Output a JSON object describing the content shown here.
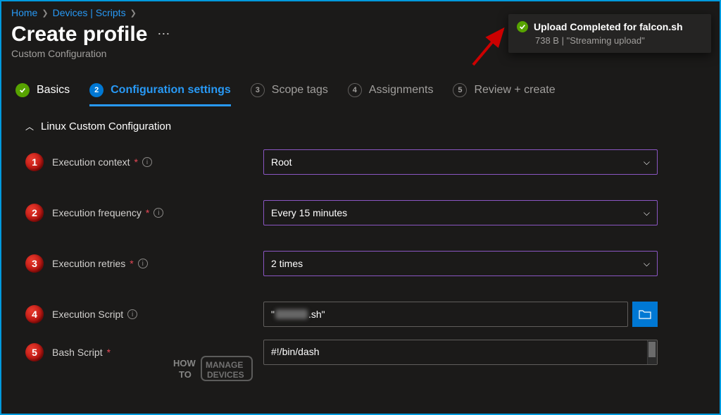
{
  "breadcrumb": {
    "home": "Home",
    "devices": "Devices | Scripts"
  },
  "page": {
    "title": "Create profile",
    "subtitle": "Custom Configuration"
  },
  "toast": {
    "title": "Upload Completed for falcon.sh",
    "sub": "738 B | \"Streaming upload\""
  },
  "steps": {
    "basics": "Basics",
    "config": "Configuration settings",
    "scope": "Scope tags",
    "assign": "Assignments",
    "review": "Review + create",
    "numbers": {
      "config": "2",
      "scope": "3",
      "assign": "4",
      "review": "5"
    }
  },
  "section": {
    "title": "Linux Custom Configuration"
  },
  "form": {
    "context": {
      "label": "Execution context",
      "value": "Root",
      "marker": "1"
    },
    "frequency": {
      "label": "Execution frequency",
      "value": "Every 15 minutes",
      "marker": "2"
    },
    "retries": {
      "label": "Execution retries",
      "value": "2 times",
      "marker": "3"
    },
    "script": {
      "label": "Execution Script",
      "prefix": "\"",
      "suffix": ".sh\"",
      "marker": "4"
    },
    "bash": {
      "label": "Bash Script",
      "value": "#!/bin/dash",
      "marker": "5"
    }
  },
  "watermark": {
    "how": "HOW",
    "to": "TO",
    "manage": "MANAGE",
    "devices": "DEVICES"
  }
}
